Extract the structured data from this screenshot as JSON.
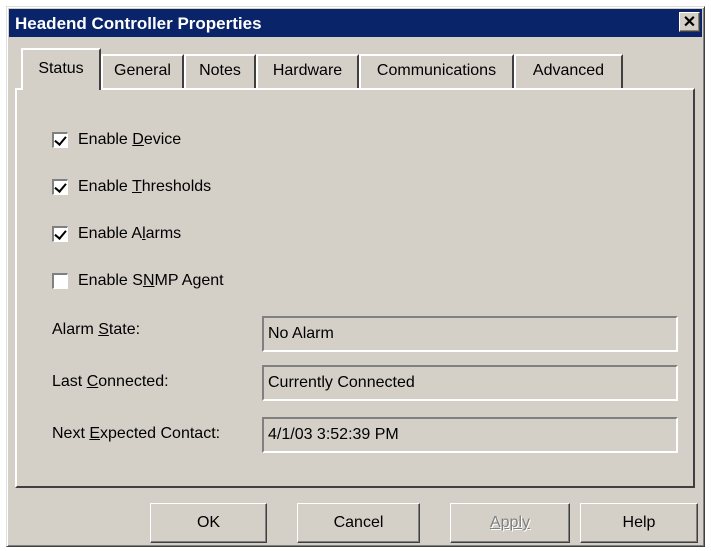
{
  "window": {
    "title": "Headend Controller Properties",
    "close_glyph": "✕"
  },
  "tabs": [
    {
      "label": "Status",
      "active": true
    },
    {
      "label": "General",
      "active": false
    },
    {
      "label": "Notes",
      "active": false
    },
    {
      "label": "Hardware",
      "active": false
    },
    {
      "label": "Communications",
      "active": false
    },
    {
      "label": "Advanced",
      "active": false
    }
  ],
  "checkboxes": [
    {
      "label_pre": "Enable ",
      "label_key": "D",
      "label_post": "evice",
      "checked": true
    },
    {
      "label_pre": "Enable ",
      "label_key": "T",
      "label_post": "hresholds",
      "checked": true
    },
    {
      "label_pre": "Enable A",
      "label_key": "l",
      "label_post": "arms",
      "checked": true
    },
    {
      "label_pre": "Enable S",
      "label_key": "N",
      "label_post": "MP Agent",
      "checked": false
    }
  ],
  "fields": [
    {
      "label_pre": "Alarm ",
      "label_key": "S",
      "label_post": "tate:",
      "value": "No Alarm"
    },
    {
      "label_pre": "Last ",
      "label_key": "C",
      "label_post": "onnected:",
      "value": "Currently Connected"
    },
    {
      "label_pre": "Next ",
      "label_key": "E",
      "label_post": "xpected Contact:",
      "value": "4/1/03 3:52:39 PM"
    }
  ],
  "buttons": {
    "ok": "OK",
    "cancel": "Cancel",
    "apply": "Apply",
    "help": "Help"
  },
  "colors": {
    "titlebar": "#0a246a",
    "face": "#d4d0c8"
  }
}
